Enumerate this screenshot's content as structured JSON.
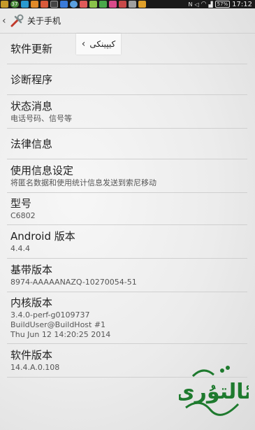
{
  "statusbar": {
    "time": "17:12",
    "battery": "57%",
    "notification_count": "37"
  },
  "actionbar": {
    "title": "关于手机"
  },
  "popup": {
    "text": "کیپینکی"
  },
  "items": [
    {
      "title": "软件更新"
    },
    {
      "title": "诊断程序"
    },
    {
      "title": "状态消息",
      "subtitle": "电话号码、信号等"
    },
    {
      "title": "法律信息"
    },
    {
      "title": "使用信息设定",
      "subtitle": "将匿名数据和使用统计信息发送到索尼移动"
    },
    {
      "title": "型号",
      "subtitle": "C6802"
    },
    {
      "title": "Android 版本",
      "subtitle": "4.4.4"
    },
    {
      "title": "基带版本",
      "subtitle": "8974-AAAAANAZQ-10270054-51"
    },
    {
      "title": "内核版本",
      "lines": [
        "3.4.0-perf-g0109737",
        "BuildUser@BuildHost #1",
        "Thu Jun 12 14:20:25 2014"
      ]
    },
    {
      "title": "软件版本",
      "subtitle": "14.4.A.0.108"
    }
  ],
  "watermark": {
    "text": "ئالتۇرى",
    "color": "#1e7a2e"
  }
}
